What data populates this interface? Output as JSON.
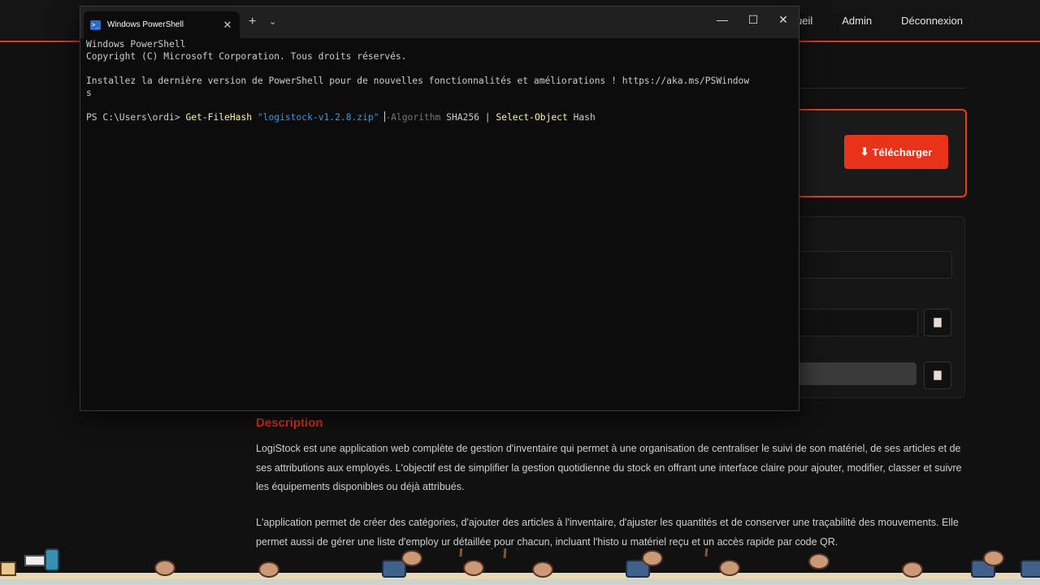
{
  "site": {
    "nav": [
      "ueil",
      "Admin",
      "Déconnexion"
    ],
    "download_button": "Télécharger",
    "download_icon": "arrow-down-icon",
    "copy_icon": "clipboard-icon",
    "description_title": "Description",
    "description_p1": "LogiStock est une application web complète de gestion d'inventaire qui permet à une organisation de centraliser le suivi de son matériel, de ses articles et de ses attributions aux employés. L'objectif est de simplifier la gestion quotidienne du stock en offrant une interface claire pour ajouter, modifier, classer et suivre les équipements disponibles ou déjà attribués.",
    "description_p2": "L'application permet de créer des catégories, d'ajouter des articles à l'inventaire, d'ajuster les quantités et de conserver une traçabilité des mouvements. Elle permet aussi de gérer une liste d'employ      ur        détaillée pour chacun, incluant l'histo         u matériel reçu et un accès rapide par code QR.",
    "accent_color": "#e8321a"
  },
  "terminal": {
    "tab_title": "Windows PowerShell",
    "tab_icon": "powershell-icon",
    "new_tab": "+",
    "dropdown": "⌄",
    "minimize": "—",
    "maximize": "☐",
    "close": "✕",
    "line1": "Windows PowerShell",
    "line2": "Copyright (C) Microsoft Corporation. Tous droits réservés.",
    "line3": "Installez la dernière version de PowerShell pour de nouvelles fonctionnalités et améliorations ! https://aka.ms/PSWindow",
    "line4": "s",
    "prompt": "PS C:\\Users\\ordi> ",
    "cmd1": "Get-FileHash",
    "arg1": "\"logistock-v1.2.8.zip\"",
    "param1": "-Algorithm",
    "arg2": " SHA256 | ",
    "cmd2": "Select-Object",
    "arg3": " Hash"
  }
}
